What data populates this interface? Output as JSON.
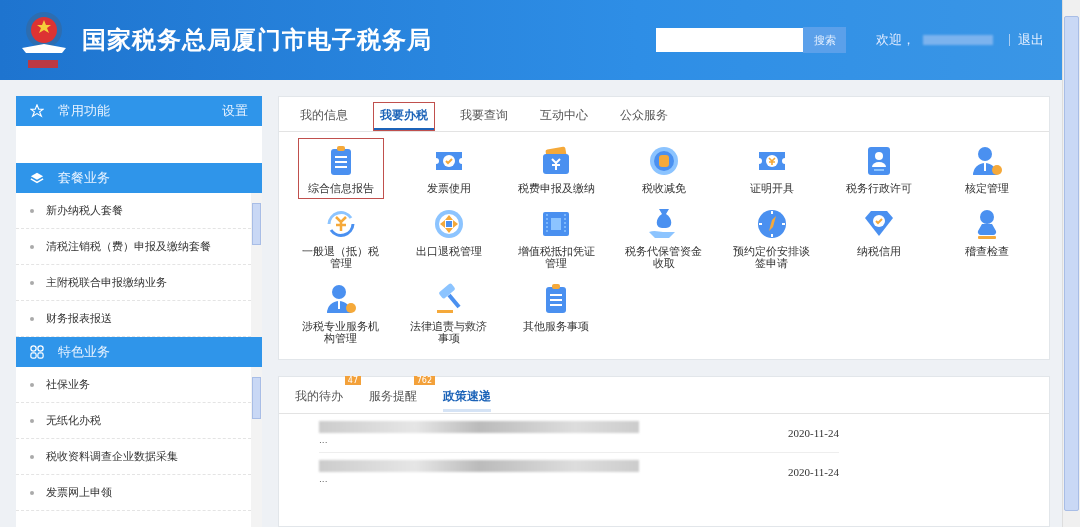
{
  "header": {
    "title": "国家税务总局厦门市电子税务局",
    "search_button": "搜索",
    "welcome": "欢迎，",
    "logout": "退出"
  },
  "sidebar": {
    "favorites": {
      "title": "常用功能",
      "action": "设置"
    },
    "sections": [
      {
        "title": "套餐业务",
        "items": [
          "新办纳税人套餐",
          "清税注销税（费）申报及缴纳套餐",
          "主附税联合申报缴纳业务",
          "财务报表报送"
        ]
      },
      {
        "title": "特色业务",
        "items": [
          "社保业务",
          "无纸化办税",
          "税收资料调查企业数据采集",
          "发票网上申领"
        ]
      }
    ]
  },
  "tabs": [
    {
      "label": "我的信息",
      "selected": false
    },
    {
      "label": "我要办税",
      "selected": true
    },
    {
      "label": "我要查询",
      "selected": false
    },
    {
      "label": "互动中心",
      "selected": false
    },
    {
      "label": "公众服务",
      "selected": false
    }
  ],
  "services": [
    {
      "label": "综合信息报告",
      "selected": true
    },
    {
      "label": "发票使用",
      "selected": false
    },
    {
      "label": "税费申报及缴纳",
      "selected": false
    },
    {
      "label": "税收减免",
      "selected": false
    },
    {
      "label": "证明开具",
      "selected": false
    },
    {
      "label": "税务行政许可",
      "selected": false
    },
    {
      "label": "核定管理",
      "selected": false
    },
    {
      "label": "一般退（抵）税管理",
      "selected": false
    },
    {
      "label": "出口退税管理",
      "selected": false
    },
    {
      "label": "增值税抵扣凭证管理",
      "selected": false
    },
    {
      "label": "税务代保管资金收取",
      "selected": false
    },
    {
      "label": "预约定价安排谈签申请",
      "selected": false
    },
    {
      "label": "纳税信用",
      "selected": false
    },
    {
      "label": "稽查检查",
      "selected": false
    },
    {
      "label": "涉税专业服务机构管理",
      "selected": false
    },
    {
      "label": "法律追责与救济事项",
      "selected": false
    },
    {
      "label": "其他服务事项",
      "selected": false
    }
  ],
  "notices": {
    "tabs": [
      {
        "label": "我的待办",
        "badge": "47",
        "selected": false
      },
      {
        "label": "服务提醒",
        "badge": "762",
        "selected": false
      },
      {
        "label": "政策速递",
        "selected": true
      }
    ],
    "rows": [
      {
        "snippet": "...",
        "date": "2020-11-24"
      },
      {
        "snippet": "...",
        "date": "2020-11-24"
      }
    ]
  }
}
